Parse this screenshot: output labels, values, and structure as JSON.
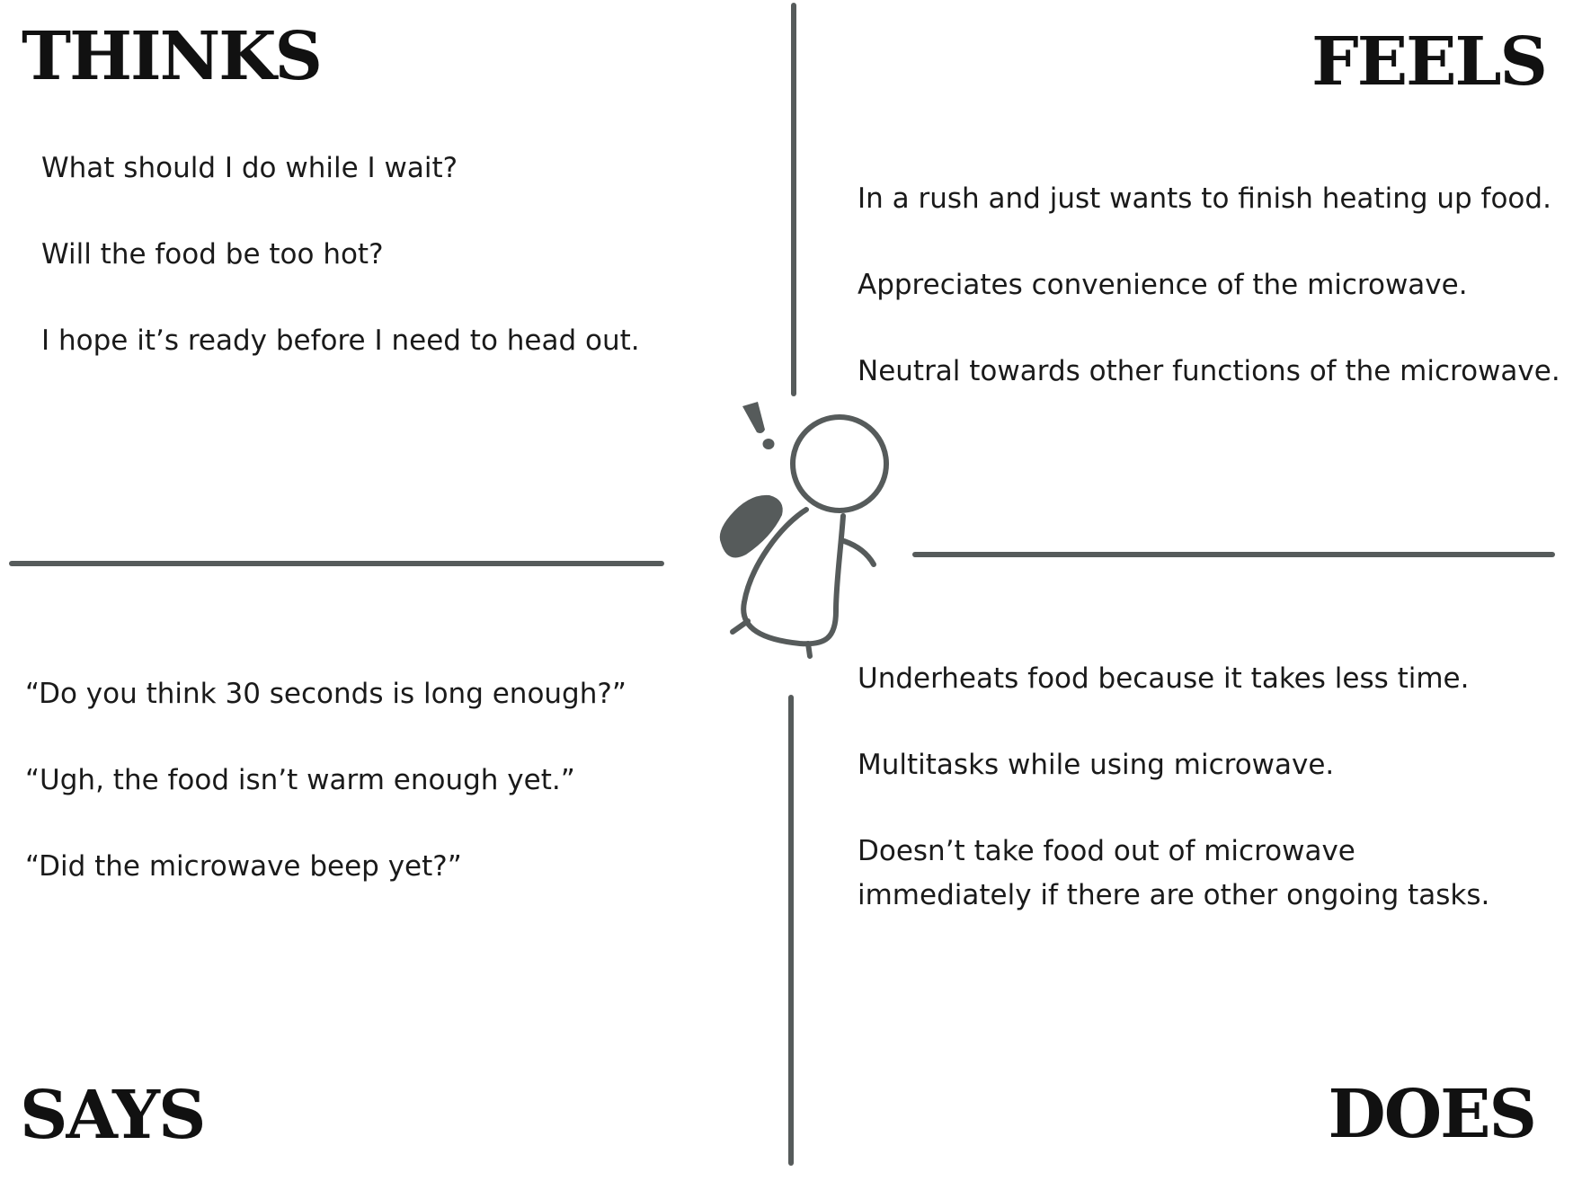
{
  "quadrants": {
    "thinks": {
      "heading": "THINKS",
      "items": [
        "What should I do while I wait?",
        "Will the food be too hot?",
        "I hope it’s ready before I need to head out."
      ]
    },
    "feels": {
      "heading": "FEELS",
      "items": [
        "In a rush and just wants to finish heating up food.",
        "Appreciates convenience of the microwave.",
        "Neutral towards other functions of the microwave."
      ]
    },
    "says": {
      "heading": "SAYS",
      "items": [
        "“Do you think 30 seconds is long enough?”",
        "“Ugh, the food isn’t warm enough yet.”",
        "“Did the microwave beep yet?”"
      ]
    },
    "does": {
      "heading": "DOES",
      "items": [
        "Underheats food because it takes less time.",
        "Multitasks while using microwave.",
        "Doesn’t take food out of microwave immediately if there are other ongoing tasks."
      ]
    }
  },
  "colors": {
    "line": "#565b5b",
    "text": "#1a1a1a"
  },
  "center_figure": {
    "icon": "person-with-exclamation-icon"
  }
}
